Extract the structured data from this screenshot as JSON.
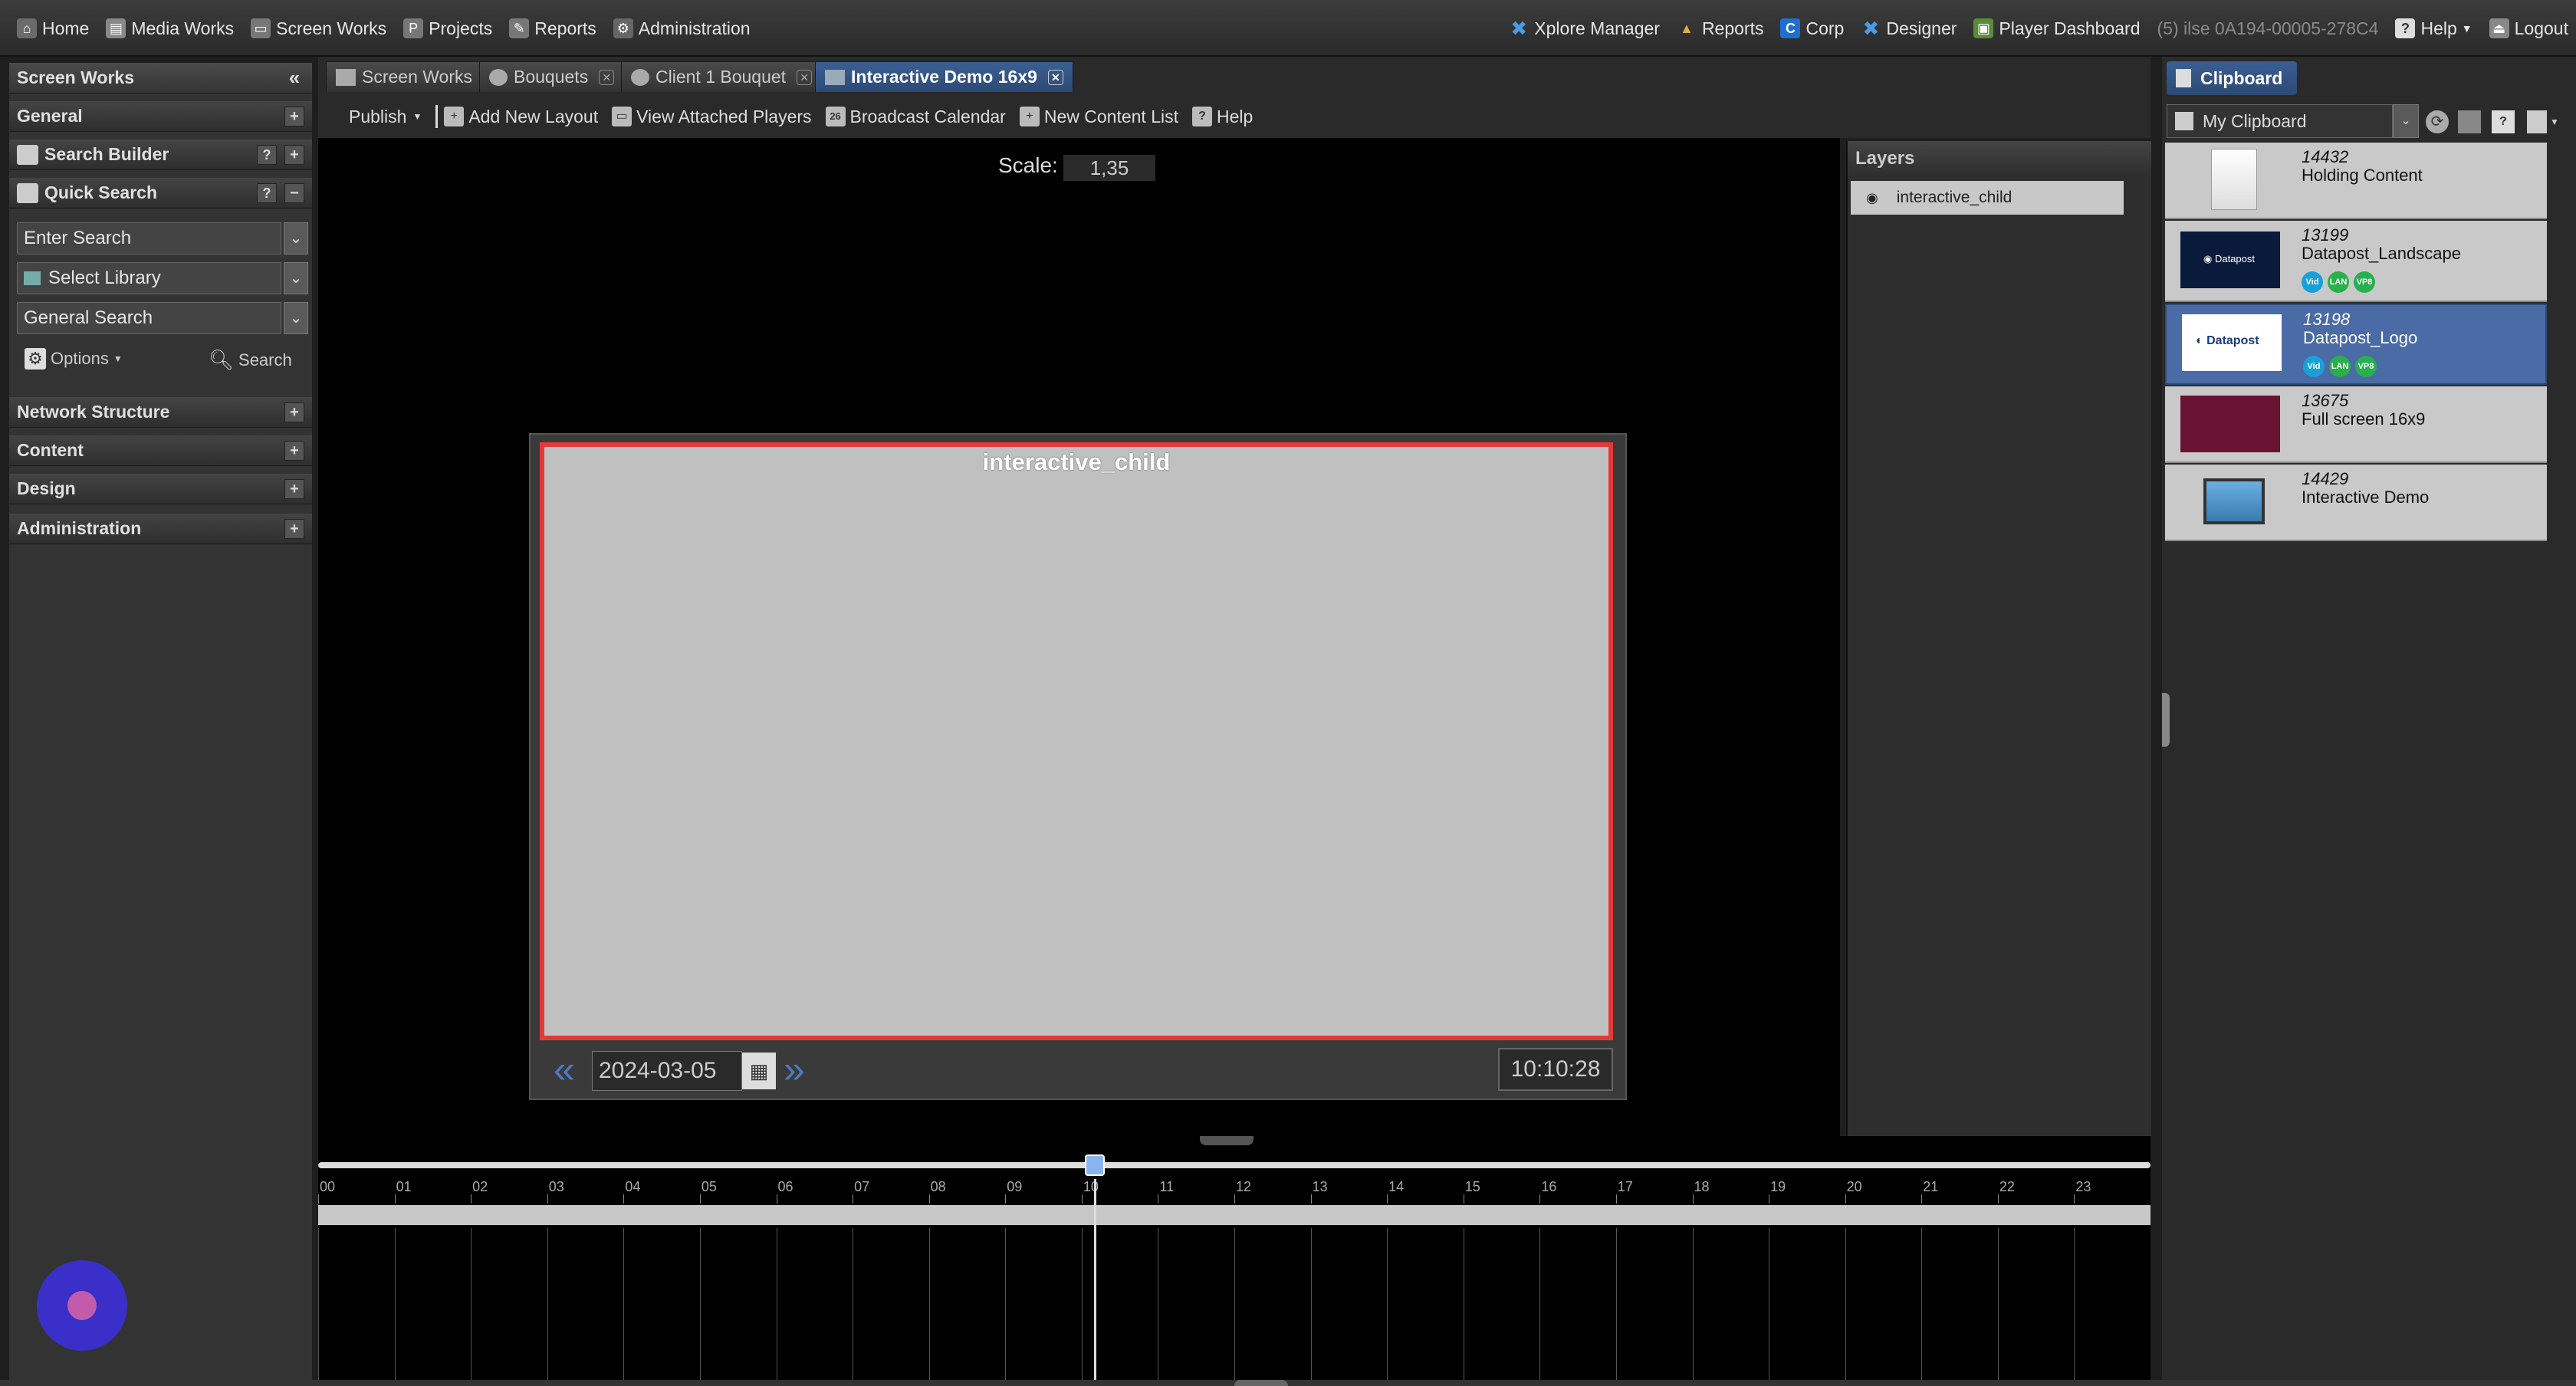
{
  "topnav": {
    "left": [
      {
        "label": "Home",
        "icon": "home-icon"
      },
      {
        "label": "Media Works",
        "icon": "media-icon"
      },
      {
        "label": "Screen Works",
        "icon": "screen-icon"
      },
      {
        "label": "Projects",
        "icon": "projects-icon"
      },
      {
        "label": "Reports",
        "icon": "reports-icon"
      },
      {
        "label": "Administration",
        "icon": "admin-icon"
      }
    ],
    "right": [
      {
        "label": "Xplore Manager",
        "icon": "xplore-icon"
      },
      {
        "label": "Reports",
        "icon": "reports-icon"
      },
      {
        "label": "Corp",
        "icon": "corp-icon"
      },
      {
        "label": "Designer",
        "icon": "designer-icon"
      },
      {
        "label": "Player Dashboard",
        "icon": "dashboard-icon"
      },
      {
        "label": "(5) ilse 0A194-00005-278C4",
        "icon": ""
      },
      {
        "label": "Help",
        "icon": "help-icon"
      },
      {
        "label": "Logout",
        "icon": "logout-icon"
      }
    ]
  },
  "left_panel": {
    "title": "Screen Works",
    "sections": {
      "general": "General",
      "search_builder": "Search Builder",
      "quick_search": "Quick Search",
      "network_structure": "Network Structure",
      "content": "Content",
      "design": "Design",
      "administration": "Administration"
    },
    "search_placeholder": "Enter Search",
    "library_select": "Select Library",
    "search_type": "General Search",
    "options_label": "Options",
    "search_button": "Search"
  },
  "tabs": [
    {
      "label": "Screen Works",
      "closable": false,
      "active": false
    },
    {
      "label": "Bouquets",
      "closable": true,
      "active": false
    },
    {
      "label": "Client 1 Bouquet",
      "closable": true,
      "active": false
    },
    {
      "label": "Interactive Demo 16x9",
      "closable": true,
      "active": true
    }
  ],
  "toolbar": {
    "publish": "Publish",
    "add_layout": "Add New Layout",
    "view_players": "View Attached Players",
    "broadcast_calendar": "Broadcast Calendar",
    "new_content_list": "New Content List",
    "help": "Help",
    "calendar_day": "26"
  },
  "canvas": {
    "scale_label": "Scale:",
    "scale_value": "1,35",
    "zone_label": "interactive_child",
    "date": "2024-03-05",
    "time": "10:10:28"
  },
  "layers": {
    "title": "Layers",
    "items": [
      "interactive_child"
    ]
  },
  "clipboard": {
    "tab": "Clipboard",
    "select": "My Clipboard",
    "items": [
      {
        "id": "14432",
        "name": "Holding Content",
        "badges": [],
        "selected": false
      },
      {
        "id": "13199",
        "name": "Datapost_Landscape",
        "badges": [
          "Vid",
          "LAN",
          "VP8"
        ],
        "selected": false
      },
      {
        "id": "13198",
        "name": "Datapost_Logo",
        "badges": [
          "Vid",
          "LAN",
          "VP8"
        ],
        "selected": true
      },
      {
        "id": "13675",
        "name": "Full screen 16x9",
        "badges": [],
        "selected": false
      },
      {
        "id": "14429",
        "name": "Interactive Demo",
        "badges": [],
        "selected": false
      }
    ]
  },
  "timeline": {
    "hours": [
      "00",
      "01",
      "02",
      "03",
      "04",
      "05",
      "06",
      "07",
      "08",
      "09",
      "10",
      "11",
      "12",
      "13",
      "14",
      "15",
      "16",
      "17",
      "18",
      "19",
      "20",
      "21",
      "22",
      "23"
    ],
    "current_position": 0.424
  },
  "colors": {
    "active_tab": "#3b5f92",
    "selection_border": "#e53935",
    "canvas_zone": "#c0c0c0",
    "fab": "#3a2fc9"
  }
}
